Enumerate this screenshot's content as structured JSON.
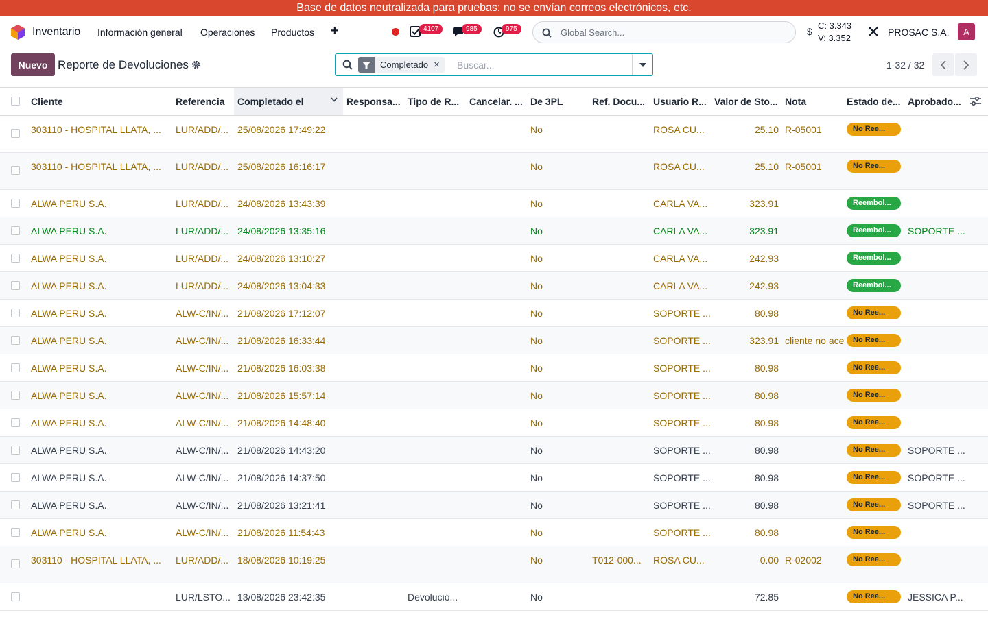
{
  "banner": "Base de datos neutralizada para pruebas: no se envían correos electrónicos, etc.",
  "navbar": {
    "app_name": "Inventario",
    "menu": [
      "Información general",
      "Operaciones",
      "Productos"
    ],
    "plus": "+",
    "badges": {
      "activities": "4107",
      "messages": "985",
      "timesheet": "975"
    },
    "search_placeholder": "Global Search...",
    "currency_symbol": "$",
    "rate_buy": "C: 3.343",
    "rate_sell": "V: 3.352",
    "company": "PROSAC S.A.",
    "avatar_letter": "A"
  },
  "control": {
    "new_label": "Nuevo",
    "title": "Reporte de Devoluciones",
    "facet": "Completado",
    "search_placeholder": "Buscar...",
    "pager": "1-32 / 32"
  },
  "colors": {
    "warning": "#9a6b00",
    "success": "#008818",
    "badge_warning": "#e9a00a",
    "badge_success": "#28a745"
  },
  "columns": [
    "Cliente",
    "Referencia",
    "Completado el",
    "Responsa...",
    "Tipo de R...",
    "Cancelar. ...",
    "De 3PL",
    "Ref. Docu...",
    "Usuario R...",
    "Valor de Sto...",
    "Nota",
    "Estado de...",
    "Aprobado..."
  ],
  "rows": [
    {
      "h": 54,
      "tone": "warning",
      "cliente": "303110 - HOSPITAL LLATA, ...",
      "ref": "LUR/ADD/...",
      "fecha": "25/08/2026 17:49:22",
      "resp": "",
      "tipo": "",
      "cancel": "",
      "tpl": "No",
      "refdoc": "",
      "usuario": "ROSA CU...",
      "valor": "25.10",
      "nota": "R-05001",
      "estado": "No Ree...",
      "estado_tone": "warning",
      "aprob": ""
    },
    {
      "h": 54,
      "tone": "warning",
      "cliente": "303110 - HOSPITAL LLATA, ...",
      "ref": "LUR/ADD/...",
      "fecha": "25/08/2026 16:16:17",
      "resp": "",
      "tipo": "",
      "cancel": "",
      "tpl": "No",
      "refdoc": "",
      "usuario": "ROSA CU...",
      "valor": "25.10",
      "nota": "R-05001",
      "estado": "No Ree...",
      "estado_tone": "warning",
      "aprob": ""
    },
    {
      "h": 40,
      "tone": "warning",
      "cliente": "ALWA PERU S.A.",
      "ref": "LUR/ADD/...",
      "fecha": "24/08/2026 13:43:39",
      "resp": "",
      "tipo": "",
      "cancel": "",
      "tpl": "No",
      "refdoc": "",
      "usuario": "CARLA VA...",
      "valor": "323.91",
      "nota": "",
      "estado": "Reembol...",
      "estado_tone": "success",
      "aprob": ""
    },
    {
      "h": 40,
      "tone": "success",
      "cliente": "ALWA PERU S.A.",
      "ref": "LUR/ADD/...",
      "fecha": "24/08/2026 13:35:16",
      "resp": "",
      "tipo": "",
      "cancel": "",
      "tpl": "No",
      "refdoc": "",
      "usuario": "CARLA VA...",
      "valor": "323.91",
      "nota": "",
      "estado": "Reembol...",
      "estado_tone": "success",
      "aprob": "SOPORTE ..."
    },
    {
      "h": 40,
      "tone": "warning",
      "cliente": "ALWA PERU S.A.",
      "ref": "LUR/ADD/...",
      "fecha": "24/08/2026 13:10:27",
      "resp": "",
      "tipo": "",
      "cancel": "",
      "tpl": "No",
      "refdoc": "",
      "usuario": "CARLA VA...",
      "valor": "242.93",
      "nota": "",
      "estado": "Reembol...",
      "estado_tone": "success",
      "aprob": ""
    },
    {
      "h": 40,
      "tone": "warning",
      "cliente": "ALWA PERU S.A.",
      "ref": "LUR/ADD/...",
      "fecha": "24/08/2026 13:04:33",
      "resp": "",
      "tipo": "",
      "cancel": "",
      "tpl": "No",
      "refdoc": "",
      "usuario": "CARLA VA...",
      "valor": "242.93",
      "nota": "",
      "estado": "Reembol...",
      "estado_tone": "success",
      "aprob": ""
    },
    {
      "h": 40,
      "tone": "warning",
      "cliente": "ALWA PERU S.A.",
      "ref": "ALW-C/IN/...",
      "fecha": "21/08/2026 17:12:07",
      "resp": "",
      "tipo": "",
      "cancel": "",
      "tpl": "No",
      "refdoc": "",
      "usuario": "SOPORTE ...",
      "valor": "80.98",
      "nota": "",
      "estado": "No Ree...",
      "estado_tone": "warning",
      "aprob": ""
    },
    {
      "h": 40,
      "tone": "warning",
      "cliente": "ALWA PERU S.A.",
      "ref": "ALW-C/IN/...",
      "fecha": "21/08/2026 16:33:44",
      "resp": "",
      "tipo": "",
      "cancel": "",
      "tpl": "No",
      "refdoc": "",
      "usuario": "SOPORTE ...",
      "valor": "323.91",
      "nota": "cliente no acepta",
      "estado": "No Ree...",
      "estado_tone": "warning",
      "aprob": ""
    },
    {
      "h": 40,
      "tone": "warning",
      "cliente": "ALWA PERU S.A.",
      "ref": "ALW-C/IN/...",
      "fecha": "21/08/2026 16:03:38",
      "resp": "",
      "tipo": "",
      "cancel": "",
      "tpl": "No",
      "refdoc": "",
      "usuario": "SOPORTE ...",
      "valor": "80.98",
      "nota": "",
      "estado": "No Ree...",
      "estado_tone": "warning",
      "aprob": ""
    },
    {
      "h": 40,
      "tone": "warning",
      "cliente": "ALWA PERU S.A.",
      "ref": "ALW-C/IN/...",
      "fecha": "21/08/2026 15:57:14",
      "resp": "",
      "tipo": "",
      "cancel": "",
      "tpl": "No",
      "refdoc": "",
      "usuario": "SOPORTE ...",
      "valor": "80.98",
      "nota": "",
      "estado": "No Ree...",
      "estado_tone": "warning",
      "aprob": ""
    },
    {
      "h": 40,
      "tone": "warning",
      "cliente": "ALWA PERU S.A.",
      "ref": "ALW-C/IN/...",
      "fecha": "21/08/2026 14:48:40",
      "resp": "",
      "tipo": "",
      "cancel": "",
      "tpl": "No",
      "refdoc": "",
      "usuario": "SOPORTE ...",
      "valor": "80.98",
      "nota": "",
      "estado": "No Ree...",
      "estado_tone": "warning",
      "aprob": ""
    },
    {
      "h": 40,
      "tone": "default",
      "cliente": "ALWA PERU S.A.",
      "ref": "ALW-C/IN/...",
      "fecha": "21/08/2026 14:43:20",
      "resp": "",
      "tipo": "",
      "cancel": "",
      "tpl": "No",
      "refdoc": "",
      "usuario": "SOPORTE ...",
      "valor": "80.98",
      "nota": "",
      "estado": "No Ree...",
      "estado_tone": "warning",
      "aprob": "SOPORTE ..."
    },
    {
      "h": 40,
      "tone": "default",
      "cliente": "ALWA PERU S.A.",
      "ref": "ALW-C/IN/...",
      "fecha": "21/08/2026 14:37:50",
      "resp": "",
      "tipo": "",
      "cancel": "",
      "tpl": "No",
      "refdoc": "",
      "usuario": "SOPORTE ...",
      "valor": "80.98",
      "nota": "",
      "estado": "No Ree...",
      "estado_tone": "warning",
      "aprob": "SOPORTE ..."
    },
    {
      "h": 40,
      "tone": "default",
      "cliente": "ALWA PERU S.A.",
      "ref": "ALW-C/IN/...",
      "fecha": "21/08/2026 13:21:41",
      "resp": "",
      "tipo": "",
      "cancel": "",
      "tpl": "No",
      "refdoc": "",
      "usuario": "SOPORTE ...",
      "valor": "80.98",
      "nota": "",
      "estado": "No Ree...",
      "estado_tone": "warning",
      "aprob": "SOPORTE ..."
    },
    {
      "h": 40,
      "tone": "warning",
      "cliente": "ALWA PERU S.A.",
      "ref": "ALW-C/IN/...",
      "fecha": "21/08/2026 11:54:43",
      "resp": "",
      "tipo": "",
      "cancel": "",
      "tpl": "No",
      "refdoc": "",
      "usuario": "SOPORTE ...",
      "valor": "80.98",
      "nota": "",
      "estado": "No Ree...",
      "estado_tone": "warning",
      "aprob": ""
    },
    {
      "h": 54,
      "tone": "warning",
      "cliente": "303110 - HOSPITAL LLATA, ...",
      "ref": "LUR/ADD/...",
      "fecha": "18/08/2026 10:19:25",
      "resp": "",
      "tipo": "",
      "cancel": "",
      "tpl": "No",
      "refdoc": "T012-000...",
      "usuario": "ROSA CU...",
      "valor": "0.00",
      "nota": "R-02002",
      "estado": "No Ree...",
      "estado_tone": "warning",
      "aprob": ""
    },
    {
      "h": 40,
      "tone": "default",
      "cliente": "",
      "ref": "LUR/LSTO...",
      "fecha": "13/08/2026 23:42:35",
      "resp": "",
      "tipo": "Devolució...",
      "cancel": "",
      "tpl": "No",
      "refdoc": "",
      "usuario": "",
      "valor": "72.85",
      "nota": "",
      "estado": "No Ree...",
      "estado_tone": "warning",
      "aprob": "JESSICA P..."
    }
  ]
}
